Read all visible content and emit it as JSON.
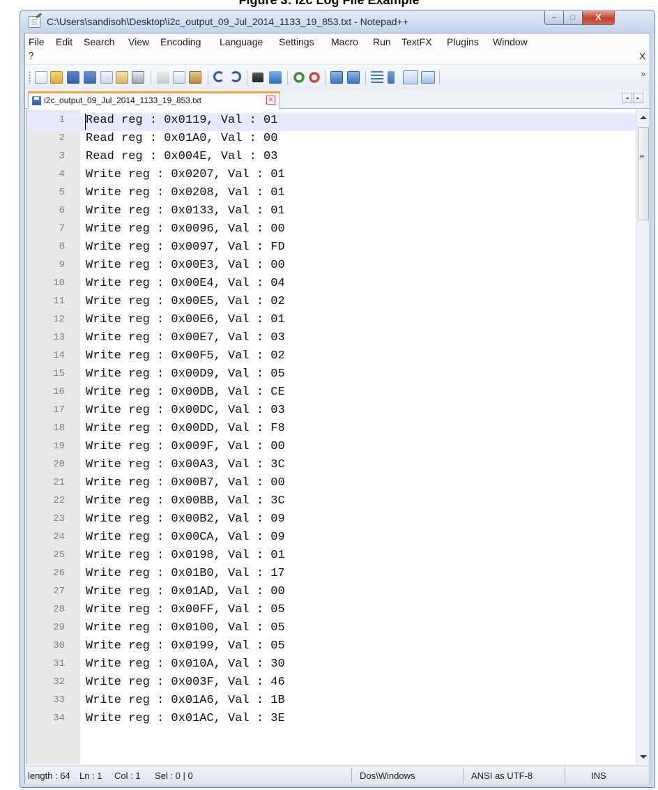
{
  "figure_caption": "Figure 3: i2c Log File Example",
  "window": {
    "title": "C:\\Users\\sandisoh\\Desktop\\i2c_output_09_Jul_2014_1133_19_853.txt - Notepad++",
    "minimize": "–",
    "maximize": "□",
    "close": "X"
  },
  "menu": {
    "items": [
      "File",
      "Edit",
      "Search",
      "View",
      "Encoding",
      "Language",
      "Settings",
      "Macro",
      "Run",
      "TextFX",
      "Plugins",
      "Window"
    ],
    "help": "?",
    "close_doc": "X"
  },
  "toolbar": {
    "icons": [
      "new-file-icon",
      "open-file-icon",
      "save-icon",
      "save-all-icon",
      "close-icon",
      "close-all-icon",
      "print-icon",
      "cut-icon",
      "copy-icon",
      "paste-icon",
      "undo-icon",
      "redo-icon",
      "find-icon",
      "replace-icon",
      "zoom-in-icon",
      "zoom-out-icon",
      "sync-vertical-icon",
      "sync-horizontal-icon",
      "word-wrap-icon",
      "show-all-chars-icon",
      "indent-guide-icon",
      "document-map-icon"
    ],
    "more": "»"
  },
  "tab": {
    "label": "i2c_output_09_Jul_2014_1133_19_853.txt",
    "close": "✕",
    "nav_left": "◂",
    "nav_right": "▸"
  },
  "editor": {
    "current_line": 1,
    "lines": [
      "Read reg : 0x0119, Val : 01",
      "Read reg : 0x01A0, Val : 00",
      "Read reg : 0x004E, Val : 03",
      "Write reg : 0x0207, Val : 01",
      "Write reg : 0x0208, Val : 01",
      "Write reg : 0x0133, Val : 01",
      "Write reg : 0x0096, Val : 00",
      "Write reg : 0x0097, Val : FD",
      "Write reg : 0x00E3, Val : 00",
      "Write reg : 0x00E4, Val : 04",
      "Write reg : 0x00E5, Val : 02",
      "Write reg : 0x00E6, Val : 01",
      "Write reg : 0x00E7, Val : 03",
      "Write reg : 0x00F5, Val : 02",
      "Write reg : 0x00D9, Val : 05",
      "Write reg : 0x00DB, Val : CE",
      "Write reg : 0x00DC, Val : 03",
      "Write reg : 0x00DD, Val : F8",
      "Write reg : 0x009F, Val : 00",
      "Write reg : 0x00A3, Val : 3C",
      "Write reg : 0x00B7, Val : 00",
      "Write reg : 0x00BB, Val : 3C",
      "Write reg : 0x00B2, Val : 09",
      "Write reg : 0x00CA, Val : 09",
      "Write reg : 0x0198, Val : 01",
      "Write reg : 0x01B0, Val : 17",
      "Write reg : 0x01AD, Val : 00",
      "Write reg : 0x00FF, Val : 05",
      "Write reg : 0x0100, Val : 05",
      "Write reg : 0x0199, Val : 05",
      "Write reg : 0x010A, Val : 30",
      "Write reg : 0x003F, Val : 46",
      "Write reg : 0x01A6, Val : 1B",
      "Write reg : 0x01AC, Val : 3E"
    ]
  },
  "status": {
    "length": "length : 64",
    "ln": "Ln : 1",
    "col": "Col : 1",
    "sel": "Sel : 0 | 0",
    "eol": "Dos\\Windows",
    "encoding": "ANSI as UTF-8",
    "mode": "INS"
  },
  "colors": {
    "current_line_bg": "#e8e8ff",
    "gutter_bg": "#e8e8e8",
    "tab_accent": "#f4a339",
    "close_button": "#c1412b"
  }
}
